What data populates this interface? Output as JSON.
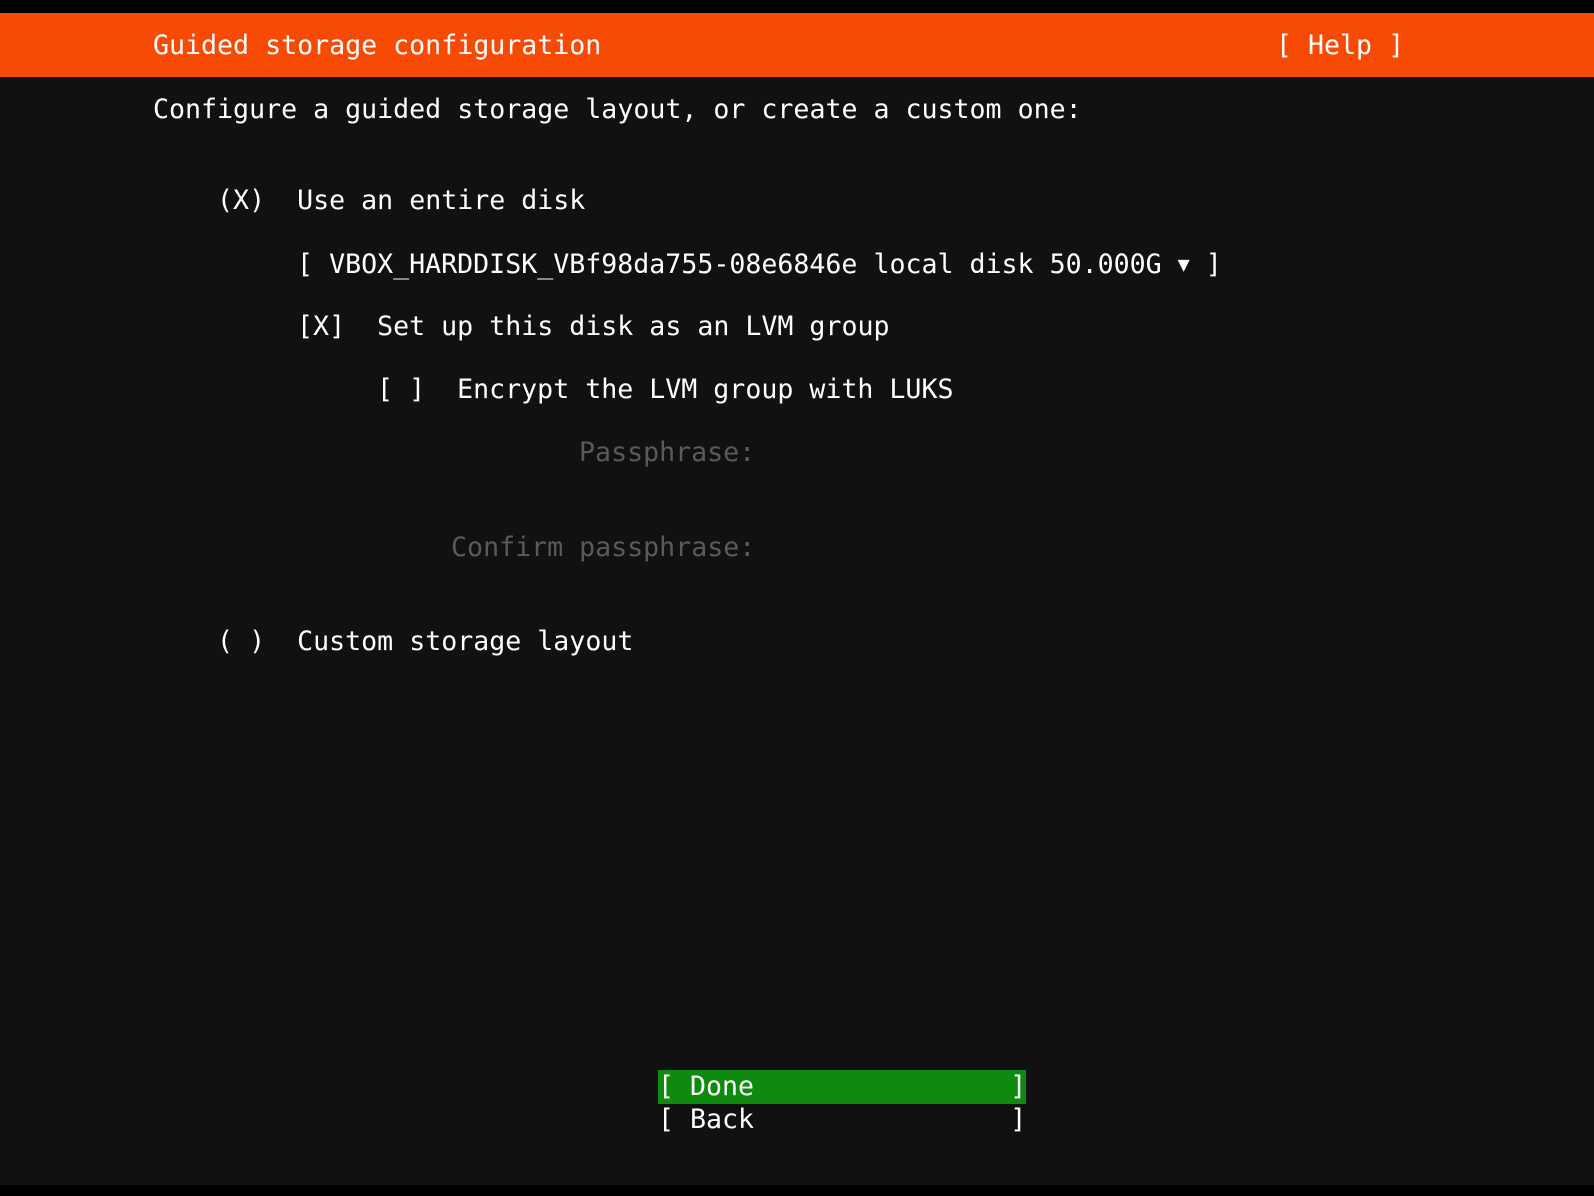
{
  "screen": {
    "background": "#111111",
    "foreground": "#ffffff",
    "dim_foreground": "#5a5a5a"
  },
  "header": {
    "title": "Guided storage configuration",
    "help_label": "[ Help ]",
    "background": "#f64a05",
    "foreground": "#ffffff"
  },
  "main": {
    "intro": "Configure a guided storage layout, or create a custom one:",
    "entire_disk": {
      "radio": "(X)",
      "label": "Use an entire disk"
    },
    "disk_select": {
      "open_bracket": "[",
      "value": "VBOX_HARDDISK_VBf98da755-08e6846e local disk 50.000G",
      "arrow_icon": "▼",
      "close_bracket": "]"
    },
    "lvm_group": {
      "checkbox": "[X]",
      "label": "Set up this disk as an LVM group"
    },
    "luks_encrypt": {
      "checkbox": "[ ]",
      "label": "Encrypt the LVM group with LUKS"
    },
    "passphrase": {
      "label": "Passphrase:",
      "value": "",
      "enabled": false
    },
    "confirm_passphrase": {
      "label": "Confirm passphrase:",
      "value": "",
      "enabled": false
    },
    "custom_layout": {
      "radio": "( )",
      "label": "Custom storage layout"
    }
  },
  "footer": {
    "done": "[ Done                ]",
    "back": "[ Back                ]",
    "done_background": "#0e8a0e"
  }
}
